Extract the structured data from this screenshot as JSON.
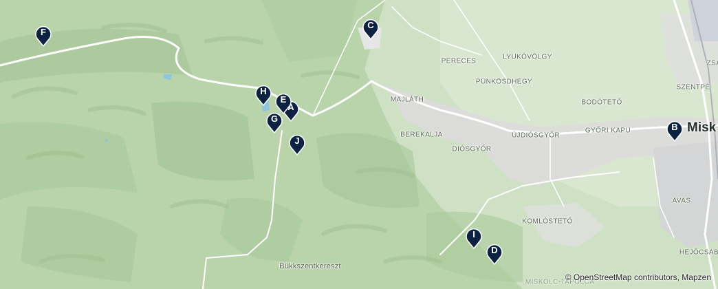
{
  "places": {
    "miskolc": "Misk",
    "zsa": "ZSA",
    "szentpe": "SZENTPÉ",
    "pereces": "PERECES",
    "lyukovolgy": "LYUKÓVÖLGY",
    "punkosdhegy": "PÜNKÖSDHEGY",
    "majlath": "MAJLÁTH",
    "bodotetO": "BODÓTETŐ",
    "berekalja": "BEREKALJA",
    "ujdiosgyor": "ÚJDIÓSGYŐR",
    "gyori_kapu": "GYŐRI KAPU",
    "diosgyor": "DIÓSGYŐR",
    "avas": "AVAS",
    "komlostetO": "KOMLÓSTETŐ",
    "bukkszentkereszt": "Bükkszentkereszt",
    "hejocsaba": "HEJŐCSABA",
    "miskolc_tapolca": "MISKOLC-TAPOLCA"
  },
  "markers": [
    {
      "label": "F"
    },
    {
      "label": "C"
    },
    {
      "label": "H"
    },
    {
      "label": "E"
    },
    {
      "label": "A"
    },
    {
      "label": "G"
    },
    {
      "label": "J"
    },
    {
      "label": "B"
    },
    {
      "label": "I"
    },
    {
      "label": "D"
    }
  ],
  "marker_color": "#0d2240",
  "attribution": {
    "prefix": "© ",
    "osm": "OpenStreetMap",
    "rest": " contributors, Mapzen"
  }
}
